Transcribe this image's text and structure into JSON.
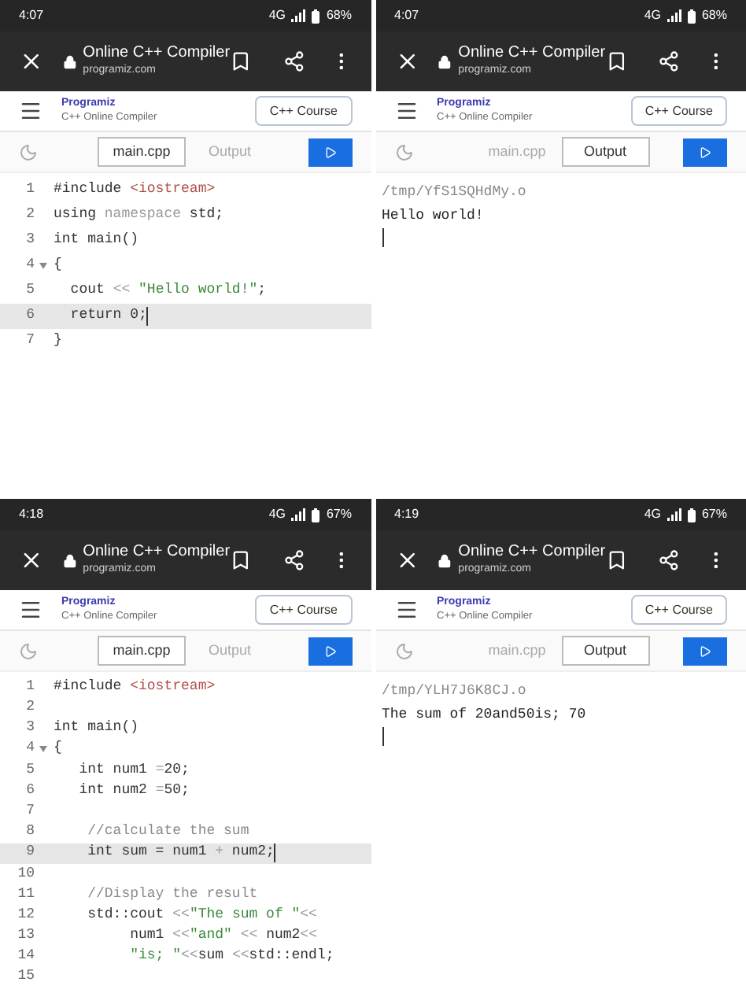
{
  "panels": [
    {
      "status_bar": {
        "time": "4:07",
        "network": "4G",
        "battery": "68%"
      },
      "browser": {
        "title": "Online C++ Compiler",
        "url": "programiz.com"
      },
      "header": {
        "logo": "Programiz",
        "subtitle": "C++ Online Compiler",
        "course_button": "C++ Course"
      },
      "tabs": [
        {
          "label": "main.cpp",
          "selected": true
        },
        {
          "label": "Output",
          "selected": false
        }
      ],
      "view": {
        "kind": "editor",
        "lines": [
          {
            "number": "1",
            "fold": false,
            "current": false,
            "tokens": [
              {
                "kind": "plain",
                "text": "#include "
              },
              {
                "kind": "header",
                "text": "<iostream>"
              }
            ]
          },
          {
            "number": "2",
            "fold": false,
            "current": false,
            "tokens": [
              {
                "kind": "plain",
                "text": "using "
              },
              {
                "kind": "muted",
                "text": "namespace"
              },
              {
                "kind": "plain",
                "text": " std;"
              }
            ]
          },
          {
            "number": "3",
            "fold": false,
            "current": false,
            "tokens": [
              {
                "kind": "plain",
                "text": "int main()"
              }
            ]
          },
          {
            "number": "4",
            "fold": true,
            "current": false,
            "tokens": [
              {
                "kind": "plain",
                "text": "{"
              }
            ]
          },
          {
            "number": "5",
            "fold": false,
            "current": false,
            "tokens": [
              {
                "kind": "plain",
                "text": "  cout "
              },
              {
                "kind": "muted",
                "text": "<<"
              },
              {
                "kind": "string",
                "text": " \"Hello world!\""
              },
              {
                "kind": "plain",
                "text": ";"
              }
            ]
          },
          {
            "number": "6",
            "fold": false,
            "current": true,
            "tokens": [
              {
                "kind": "plain",
                "text": "  return 0;"
              }
            ]
          },
          {
            "number": "7",
            "fold": false,
            "current": false,
            "tokens": [
              {
                "kind": "plain",
                "text": "}"
              }
            ]
          }
        ]
      }
    },
    {
      "status_bar": {
        "time": "4:07",
        "network": "4G",
        "battery": "68%"
      },
      "browser": {
        "title": "Online C++ Compiler",
        "url": "programiz.com"
      },
      "header": {
        "logo": "Programiz",
        "subtitle": "C++ Online Compiler",
        "course_button": "C++ Course"
      },
      "tabs": [
        {
          "label": "main.cpp",
          "selected": false
        },
        {
          "label": "Output",
          "selected": true
        }
      ],
      "view": {
        "kind": "output",
        "path": "/tmp/YfS1SQHdMy.o",
        "lines": [
          "Hello world!"
        ]
      }
    },
    {
      "status_bar": {
        "time": "4:18",
        "network": "4G",
        "battery": "67%"
      },
      "browser": {
        "title": "Online C++ Compiler",
        "url": "programiz.com"
      },
      "header": {
        "logo": "Programiz",
        "subtitle": "C++ Online Compiler",
        "course_button": "C++ Course"
      },
      "tabs": [
        {
          "label": "main.cpp",
          "selected": true
        },
        {
          "label": "Output",
          "selected": false
        }
      ],
      "view": {
        "kind": "editor",
        "lines": [
          {
            "number": "1",
            "fold": false,
            "current": false,
            "tokens": [
              {
                "kind": "plain",
                "text": "#include "
              },
              {
                "kind": "header",
                "text": "<iostream>"
              }
            ]
          },
          {
            "number": "2",
            "fold": false,
            "current": false
          },
          {
            "number": "3",
            "fold": false,
            "current": false,
            "tokens": [
              {
                "kind": "plain",
                "text": "int main()"
              }
            ]
          },
          {
            "number": "4",
            "fold": true,
            "current": false,
            "tokens": [
              {
                "kind": "plain",
                "text": "{"
              }
            ]
          },
          {
            "number": "5",
            "fold": false,
            "current": false,
            "tokens": [
              {
                "kind": "plain",
                "text": "   int num1 "
              },
              {
                "kind": "muted",
                "text": "="
              },
              {
                "kind": "plain",
                "text": "20;"
              }
            ]
          },
          {
            "number": "6",
            "fold": false,
            "current": false,
            "tokens": [
              {
                "kind": "plain",
                "text": "   int num2 "
              },
              {
                "kind": "muted",
                "text": "="
              },
              {
                "kind": "plain",
                "text": "50;"
              }
            ]
          },
          {
            "number": "7",
            "fold": false,
            "current": false
          },
          {
            "number": "8",
            "fold": false,
            "current": false,
            "tokens": [
              {
                "kind": "comment",
                "text": "    //calculate the sum"
              }
            ]
          },
          {
            "number": "9",
            "fold": false,
            "current": true,
            "tokens": [
              {
                "kind": "plain",
                "text": "    int sum = num1 "
              },
              {
                "kind": "muted",
                "text": "+"
              },
              {
                "kind": "plain",
                "text": " num2;"
              }
            ]
          },
          {
            "number": "10",
            "fold": false,
            "current": false
          },
          {
            "number": "11",
            "fold": false,
            "current": false,
            "tokens": [
              {
                "kind": "comment",
                "text": "    //Display the result"
              }
            ]
          },
          {
            "number": "12",
            "fold": false,
            "current": false,
            "tokens": [
              {
                "kind": "plain",
                "text": "    std::cout "
              },
              {
                "kind": "muted",
                "text": "<<"
              },
              {
                "kind": "string",
                "text": "\"The sum of \""
              },
              {
                "kind": "muted",
                "text": "<<"
              }
            ]
          },
          {
            "number": "13",
            "fold": false,
            "current": false,
            "tokens": [
              {
                "kind": "plain",
                "text": "         num1 "
              },
              {
                "kind": "muted",
                "text": "<<"
              },
              {
                "kind": "string",
                "text": "\"and\""
              },
              {
                "kind": "muted",
                "text": " << "
              },
              {
                "kind": "plain",
                "text": "num2"
              },
              {
                "kind": "muted",
                "text": "<<"
              }
            ]
          },
          {
            "number": "14",
            "fold": false,
            "current": false,
            "tokens": [
              {
                "kind": "string",
                "text": "         \"is; \""
              },
              {
                "kind": "muted",
                "text": "<<"
              },
              {
                "kind": "plain",
                "text": "sum "
              },
              {
                "kind": "muted",
                "text": "<<"
              },
              {
                "kind": "plain",
                "text": "std::endl;"
              }
            ]
          },
          {
            "number": "15",
            "fold": false,
            "current": false
          }
        ]
      }
    },
    {
      "status_bar": {
        "time": "4:19",
        "network": "4G",
        "battery": "67%"
      },
      "browser": {
        "title": "Online C++ Compiler",
        "url": "programiz.com"
      },
      "header": {
        "logo": "Programiz",
        "subtitle": "C++ Online Compiler",
        "course_button": "C++ Course"
      },
      "tabs": [
        {
          "label": "main.cpp",
          "selected": false
        },
        {
          "label": "Output",
          "selected": true
        }
      ],
      "view": {
        "kind": "output",
        "path": "/tmp/YLH7J6K8CJ.o",
        "lines": [
          "The sum of 20and50is; 70"
        ]
      }
    }
  ]
}
